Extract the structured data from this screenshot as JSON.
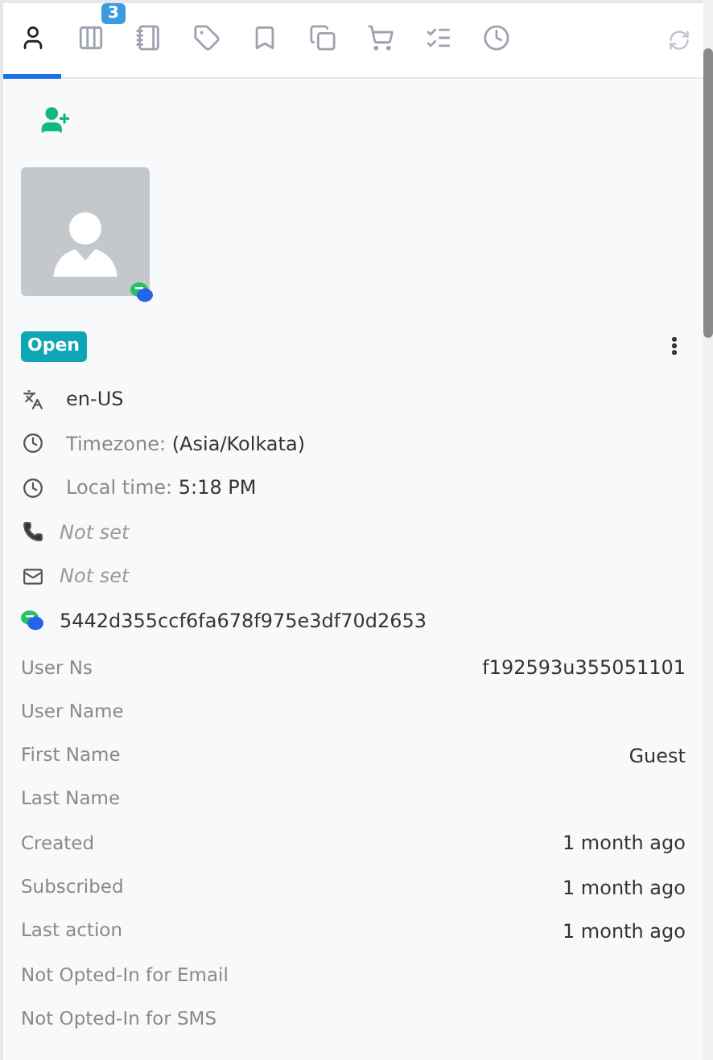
{
  "tabs": [
    {
      "selected": true
    },
    {
      "selected": false,
      "badge": "3"
    },
    {
      "selected": false
    },
    {
      "selected": false
    },
    {
      "selected": false
    },
    {
      "selected": false
    },
    {
      "selected": false
    },
    {
      "selected": false
    },
    {
      "selected": false
    }
  ],
  "status": "Open",
  "info": [
    {
      "kind": "language",
      "value": "en-US"
    },
    {
      "kind": "clock",
      "label": "Timezone:",
      "value": "(Asia/Kolkata)"
    },
    {
      "kind": "clock",
      "label": "Local time:",
      "value": "5:18 PM"
    },
    {
      "kind": "phone",
      "value": "Not set",
      "unset": true
    },
    {
      "kind": "email",
      "value": "Not set",
      "unset": true
    },
    {
      "kind": "chat",
      "value": "5442d355ccf6fa678f975e3df70d2653"
    }
  ],
  "attributes": [
    {
      "label": "User Ns",
      "value": "f192593u355051101"
    },
    {
      "label": "User Name"
    },
    {
      "label": "First Name",
      "value": "Guest"
    },
    {
      "label": "Last Name"
    },
    {
      "label": "Created",
      "value": "1 month ago"
    },
    {
      "label": "Subscribed",
      "value": "1 month ago"
    },
    {
      "label": "Last action",
      "value": "1 month ago"
    },
    {
      "label": "Not Opted-In for Email"
    },
    {
      "label": "Not Opted-In for SMS"
    }
  ]
}
